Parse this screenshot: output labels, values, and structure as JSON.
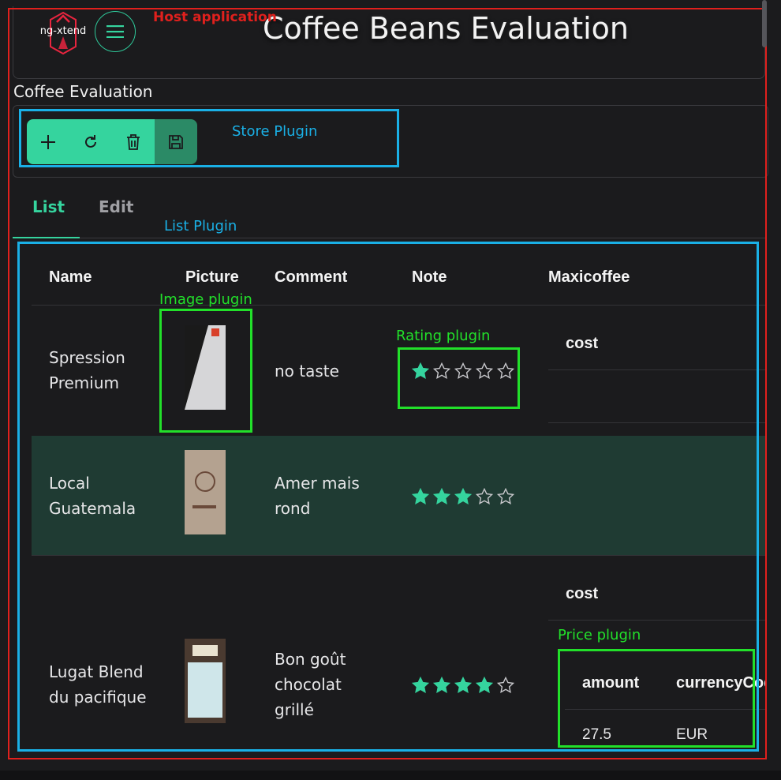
{
  "header": {
    "logo_text": "ng-xtend",
    "title": "Coffee Beans Evaluation"
  },
  "section": {
    "title": "Coffee Evaluation"
  },
  "toolbar": {
    "add_icon": "plus-icon",
    "refresh_icon": "refresh-icon",
    "delete_icon": "trash-icon",
    "save_icon": "save-icon"
  },
  "tabs": [
    {
      "label": "List",
      "active": true
    },
    {
      "label": "Edit",
      "active": false
    }
  ],
  "table": {
    "headers": [
      "Name",
      "Picture",
      "Comment",
      "Note",
      "Maxicoffee"
    ],
    "rows": [
      {
        "name": [
          "Spression",
          "Premium"
        ],
        "comment": [
          "no taste"
        ],
        "rating": 1,
        "max_rating": 5,
        "maxicoffee": {
          "cost_label": "cost"
        }
      },
      {
        "name": [
          "Local",
          "Guatemala"
        ],
        "comment": [
          "Amer mais",
          "rond"
        ],
        "rating": 3,
        "max_rating": 5,
        "highlighted": true
      },
      {
        "name": [
          "Lugat Blend",
          "du pacifique"
        ],
        "comment": [
          "Bon goût",
          "chocolat",
          "grillé"
        ],
        "rating": 4,
        "max_rating": 5,
        "maxicoffee": {
          "cost_label": "cost",
          "price": {
            "headers": [
              "amount",
              "currencyCode"
            ],
            "amount": "27.5",
            "currency": "EUR"
          }
        }
      }
    ]
  },
  "annotations": {
    "host": "Host application",
    "store": "Store Plugin",
    "list": "List Plugin",
    "image": "Image plugin",
    "rating": "Rating plugin",
    "price": "Price plugin"
  },
  "colors": {
    "accent": "#35d49e",
    "annotation_red": "#e0201d",
    "annotation_blue": "#1ab0e6",
    "annotation_green": "#22e02a"
  }
}
